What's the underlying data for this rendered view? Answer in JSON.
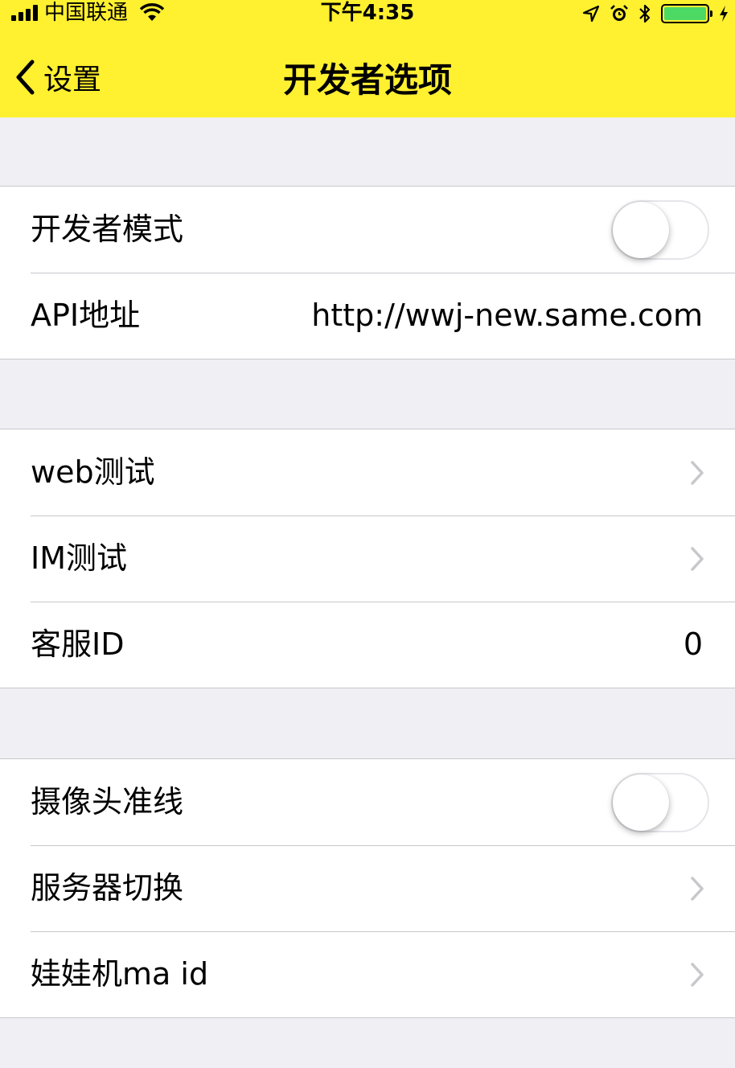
{
  "status_bar": {
    "carrier": "中国联通",
    "time": "下午4:35",
    "battery_color": "#4cd964"
  },
  "nav": {
    "back_label": "设置",
    "title": "开发者选项",
    "bar_color": "#fff030"
  },
  "groups": [
    {
      "rows": [
        {
          "label": "开发者模式",
          "control": "toggle",
          "on": false
        },
        {
          "label": "API地址",
          "value": "http://wwj-new.same.com"
        }
      ]
    },
    {
      "rows": [
        {
          "label": "web测试",
          "control": "chevron"
        },
        {
          "label": "IM测试",
          "control": "chevron"
        },
        {
          "label": "客服ID",
          "value": "0"
        }
      ]
    },
    {
      "rows": [
        {
          "label": "摄像头准线",
          "control": "toggle",
          "on": false
        },
        {
          "label": "服务器切换",
          "control": "chevron"
        },
        {
          "label": "娃娃机ma id",
          "control": "chevron"
        }
      ]
    }
  ]
}
